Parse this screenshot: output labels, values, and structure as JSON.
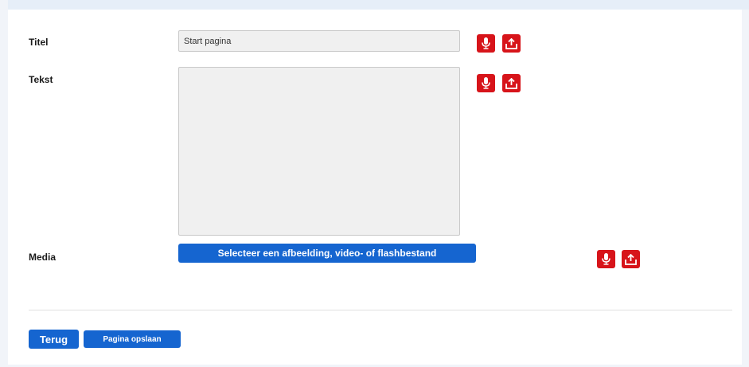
{
  "form": {
    "title_label": "Titel",
    "title_value": "Start pagina",
    "text_label": "Tekst",
    "text_value": "",
    "media_label": "Media",
    "media_button": "Selecteer een afbeelding, video- of flashbestand"
  },
  "icons": {
    "record": "microphone-icon",
    "upload": "upload-icon",
    "color": "#d7141a"
  },
  "footer": {
    "back_button": "Terug",
    "save_button": "Pagina opslaan"
  },
  "colors": {
    "primary_button": "#1565d0",
    "icon_button": "#d7141a",
    "field_background": "#f0f0f0"
  }
}
